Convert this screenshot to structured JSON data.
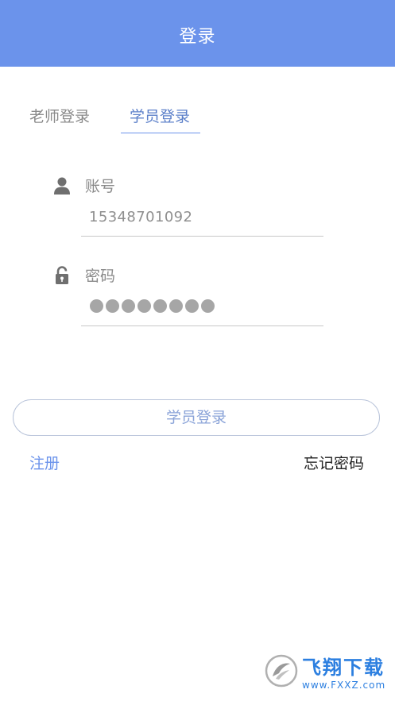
{
  "header": {
    "title": "登录"
  },
  "tabs": {
    "teacher": "老师登录",
    "student": "学员登录",
    "active": "student"
  },
  "account": {
    "label": "账号",
    "value": "15348701092",
    "icon": "user-icon"
  },
  "password": {
    "label": "密码",
    "mask_count": 8,
    "icon": "unlock-icon"
  },
  "actions": {
    "login_label": "学员登录",
    "register_label": "注册",
    "forgot_label": "忘记密码"
  },
  "colors": {
    "accent": "#6b93eb",
    "muted_text": "#8a8a8a"
  },
  "watermark": {
    "title": "飞翔下载",
    "url": "www.FXXZ.com"
  }
}
